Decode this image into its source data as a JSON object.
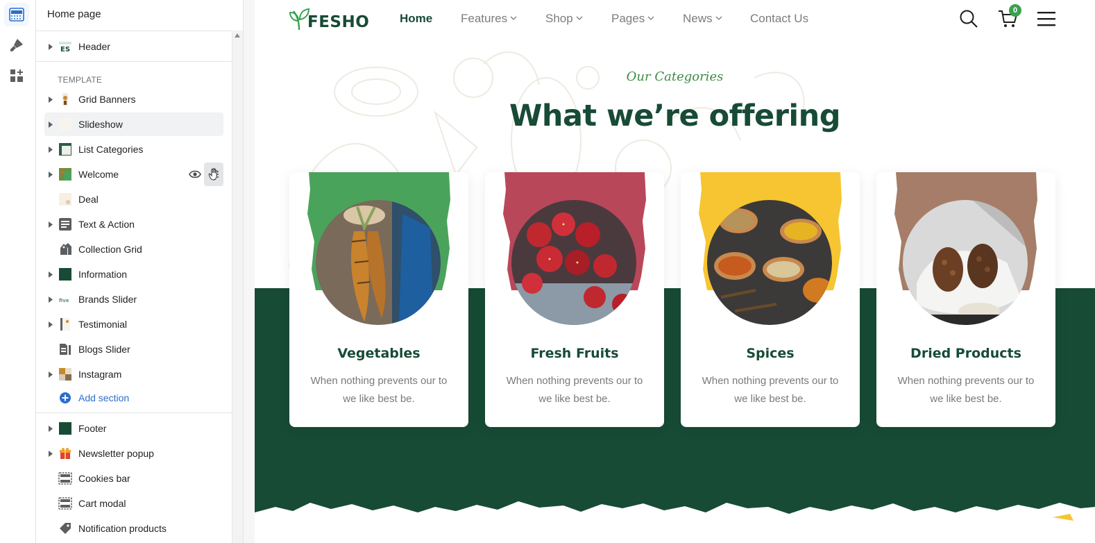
{
  "sidebar": {
    "title": "Home page",
    "header_section": "Header",
    "template_label": "TEMPLATE",
    "sections": [
      {
        "label": "Grid Banners"
      },
      {
        "label": "Slideshow"
      },
      {
        "label": "List Categories"
      },
      {
        "label": "Welcome"
      },
      {
        "label": "Deal"
      },
      {
        "label": "Text & Action"
      },
      {
        "label": "Collection Grid"
      },
      {
        "label": "Information"
      },
      {
        "label": "Brands Slider"
      },
      {
        "label": "Testimonial"
      },
      {
        "label": "Blogs Slider"
      },
      {
        "label": "Instagram"
      }
    ],
    "add_section": "Add section",
    "footer_sections": [
      {
        "label": "Footer"
      },
      {
        "label": "Newsletter popup"
      },
      {
        "label": "Cookies bar"
      },
      {
        "label": "Cart modal"
      },
      {
        "label": "Notification products"
      }
    ]
  },
  "store": {
    "logo": "FESHO",
    "nav": [
      "Home",
      "Features",
      "Shop",
      "Pages",
      "News",
      "Contact Us"
    ],
    "cart_count": "0",
    "eyebrow": "Our Categories",
    "section_title": "What we’re offering",
    "categories": [
      {
        "title": "Vegetables",
        "text": "When nothing prevents our to we like best be.",
        "color": "#4aa35b"
      },
      {
        "title": "Fresh Fruits",
        "text": "When nothing prevents our to we like best be.",
        "color": "#b9475a"
      },
      {
        "title": "Spices",
        "text": "When nothing prevents our to we like best be.",
        "color": "#f7c531"
      },
      {
        "title": "Dried Products",
        "text": "When nothing prevents our to we like best be.",
        "color": "#a57d68"
      }
    ]
  },
  "colors": {
    "brand_green": "#174b36",
    "accent_green": "#3aa14f",
    "link_blue": "#2c6ecb"
  }
}
